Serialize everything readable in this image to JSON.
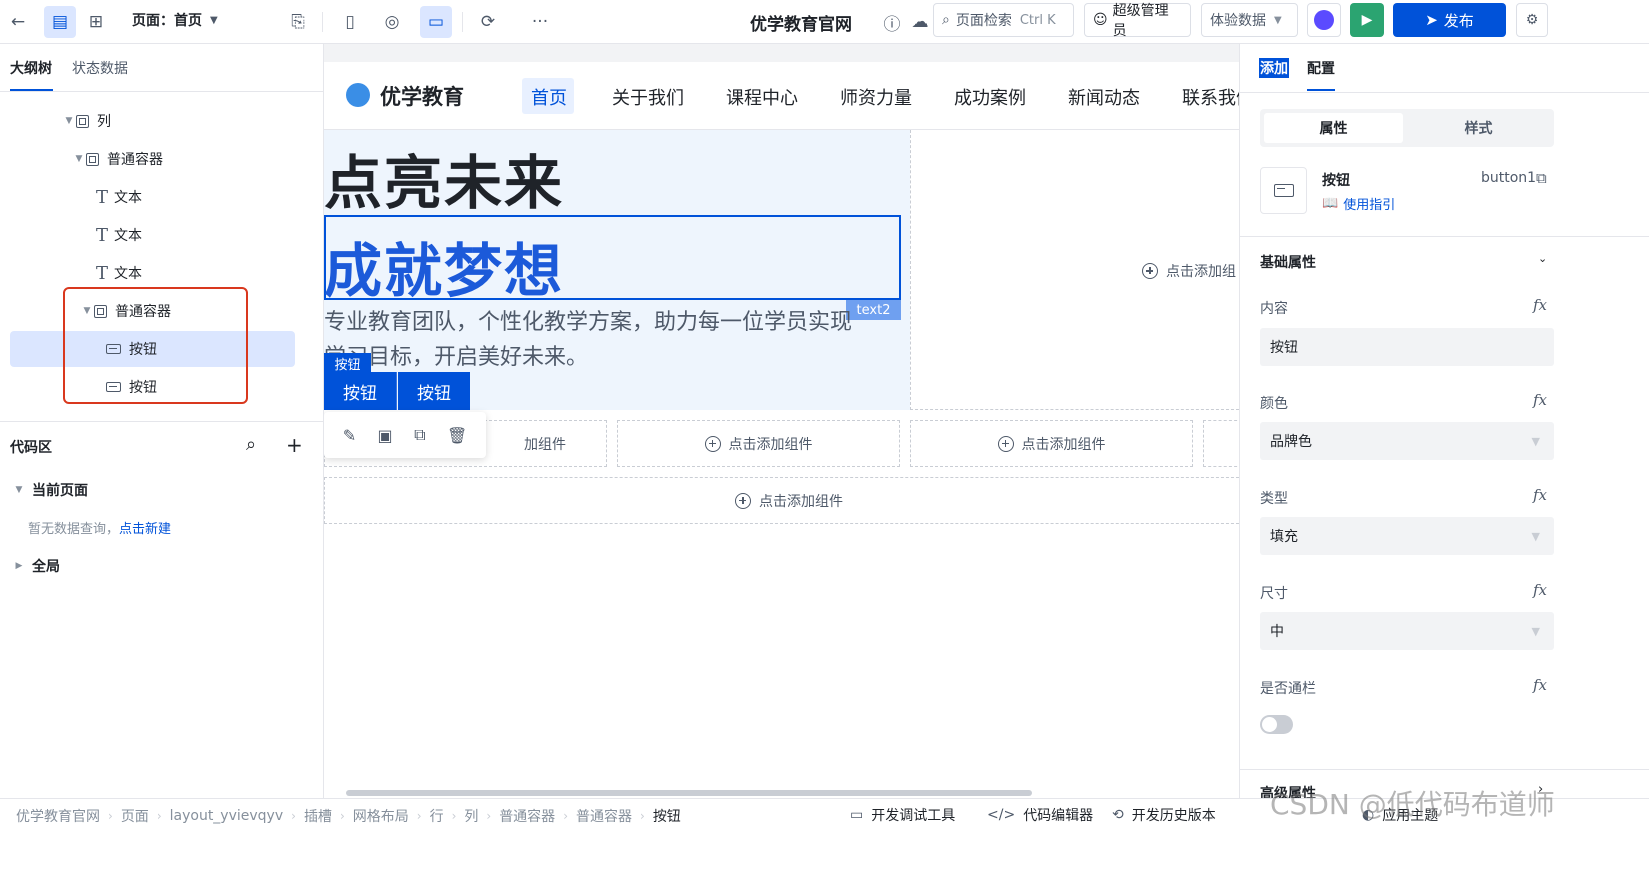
{
  "topbar": {
    "page_label": "页面：首页",
    "app_title": "优学教育官网",
    "search_label": "页面检索",
    "search_shortcut": "Ctrl K",
    "user_label": "超级管理员",
    "data_label": "体验数据",
    "publish_label": "发布"
  },
  "left_panel": {
    "tab_outline": "大纲树",
    "tab_state": "状态数据",
    "tree": [
      {
        "label": "列"
      },
      {
        "label": "普通容器"
      },
      {
        "label": "文本"
      },
      {
        "label": "文本"
      },
      {
        "label": "文本"
      },
      {
        "label": "普通容器"
      },
      {
        "label": "按钮"
      },
      {
        "label": "按钮"
      }
    ],
    "code_title": "代码区",
    "current_page": "当前页面",
    "no_data": "暂无数据查询，",
    "new_link": "点击新建",
    "global": "全局"
  },
  "canvas": {
    "logo_text": "优学教育",
    "nav": [
      "首页",
      "关于我们",
      "课程中心",
      "师资力量",
      "成功案例",
      "新闻动态",
      "联系我们"
    ],
    "headline1": "点亮未来",
    "headline2": "成就梦想",
    "text2_tag": "text2",
    "desc_line1": "专业教育团队，个性化教学方案，助力每一位学员实现",
    "desc_line2": "学习目标，开启美好未来。",
    "button_tag": "按钮",
    "button1": "按钮",
    "button2": "按钮",
    "add_component": "点击添加组件",
    "add_component_partial": "加组件",
    "add_component_right": "点击添加组"
  },
  "right_panel": {
    "tab_add": "添加",
    "tab_config": "配置",
    "seg_props": "属性",
    "seg_style": "样式",
    "comp_name": "按钮",
    "comp_id": "button1",
    "guide_link": "使用指引",
    "section_basic": "基础属性",
    "prop_content_label": "内容",
    "prop_content_value": "按钮",
    "prop_color_label": "颜色",
    "prop_color_value": "品牌色",
    "prop_type_label": "类型",
    "prop_type_value": "填充",
    "prop_size_label": "尺寸",
    "prop_size_value": "中",
    "prop_block_label": "是否通栏",
    "section_advanced": "高级属性"
  },
  "bottombar": {
    "breadcrumbs": [
      "优学教育官网",
      "页面",
      "layout_yvievqyv",
      "插槽",
      "网格布局",
      "行",
      "列",
      "普通容器",
      "普通容器",
      "按钮"
    ],
    "tool_debug": "开发调试工具",
    "tool_code": "代码编辑器",
    "tool_history": "开发历史版本",
    "tool_theme": "应用主题",
    "watermark": "CSDN @低代码布道师"
  }
}
